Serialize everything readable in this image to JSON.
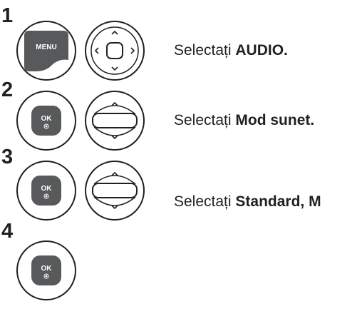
{
  "steps": [
    {
      "number": "1",
      "buttons": [
        {
          "type": "menu-key",
          "label": "MENU"
        },
        {
          "type": "dpad-four-way",
          "icon": "navigation-four-way-icon"
        }
      ],
      "text_prefix": "Selectați ",
      "text_bold": "AUDIO."
    },
    {
      "number": "2",
      "buttons": [
        {
          "type": "ok-key",
          "label": "OK"
        },
        {
          "type": "dpad-up-down",
          "icon": "navigation-up-down-icon"
        }
      ],
      "text_prefix": "Selectați ",
      "text_bold": "Mod sunet."
    },
    {
      "number": "3",
      "buttons": [
        {
          "type": "ok-key",
          "label": "OK"
        },
        {
          "type": "dpad-up-down",
          "icon": "navigation-up-down-icon"
        }
      ],
      "text_prefix": "Selectați ",
      "text_bold": "Standard, M"
    },
    {
      "number": "4",
      "buttons": [
        {
          "type": "ok-key",
          "label": "OK"
        }
      ]
    }
  ]
}
